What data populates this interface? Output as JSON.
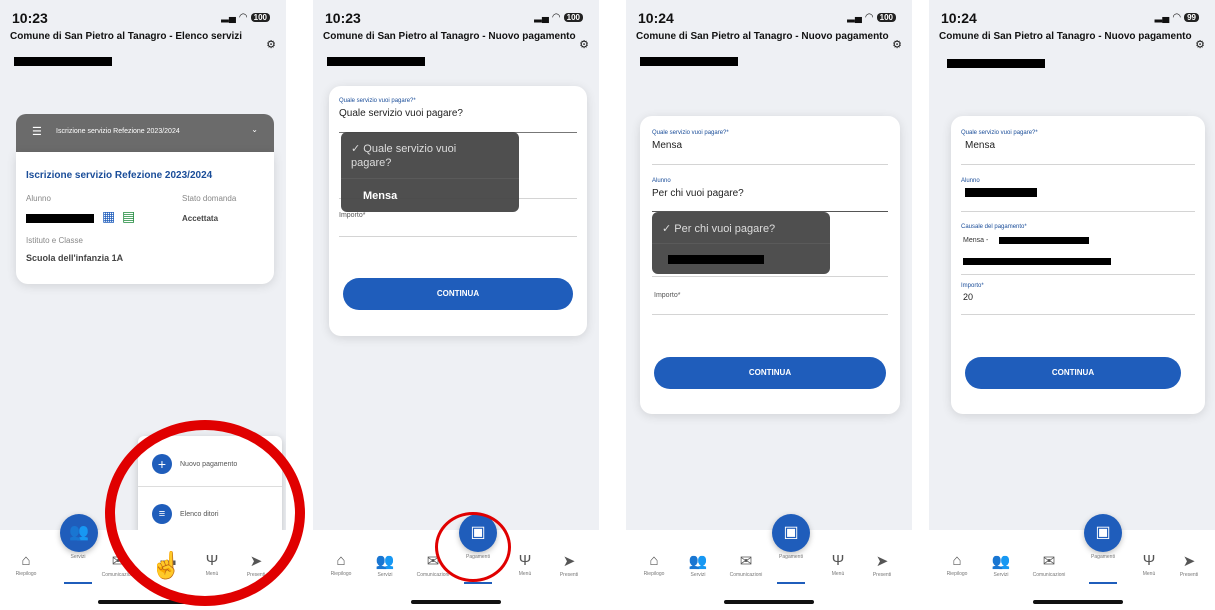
{
  "colors": {
    "accent": "#1f5dbb",
    "annotation": "#e00000",
    "dropdown_bg": "#464646"
  },
  "screen1": {
    "time": "10:23",
    "battery": "100",
    "title": "Comune di San Pietro al Tanagro - Elenco servizi",
    "banner": "Iscrizione servizio Refezione 2023/2024",
    "card_title": "Iscrizione servizio Refezione 2023/2024",
    "alunno_label": "Alunno",
    "stato_label": "Stato domanda",
    "stato_value": "Accettata",
    "istituto_label": "Istituto e Classe",
    "istituto_value": "Scuola dell'infanzia  1A",
    "menu": {
      "new_payment": "Nuovo pagamento",
      "payment_list": "Elenco ditori"
    },
    "tabs": [
      "Riepilogo",
      "Servizi",
      "Comunicazioni",
      "",
      "Menù",
      "Presenti"
    ]
  },
  "screen2": {
    "time": "10:23",
    "battery": "100",
    "title": "Comune di San Pietro al Tanagro - Nuovo pagamento",
    "service_label": "Quale servizio vuoi pagare?*",
    "service_value": "Quale servizio vuoi pagare?",
    "dropdown": {
      "option_placeholder": "Quale servizio vuoi pagare?",
      "option_mensa": "Mensa"
    },
    "importo_label": "Importo*",
    "button": "CONTINUA",
    "tabs": [
      "Riepilogo",
      "Servizi",
      "Comunicazioni",
      "Pagamenti",
      "Menù",
      "Presenti"
    ]
  },
  "screen3": {
    "time": "10:24",
    "battery": "100",
    "title": "Comune di San Pietro al Tanagro - Nuovo pagamento",
    "service_label": "Quale servizio vuoi pagare?*",
    "service_value": "Mensa",
    "alunno_label": "Alunno",
    "alunno_value": "Per chi vuoi pagare?",
    "dropdown": {
      "option_placeholder": "Per chi vuoi pagare?"
    },
    "importo_label": "Importo*",
    "button": "CONTINUA",
    "tabs": [
      "Riepilogo",
      "Servizi",
      "Comunicazioni",
      "Pagamenti",
      "Menù",
      "Presenti"
    ]
  },
  "screen4": {
    "time": "10:24",
    "battery": "99",
    "title": "Comune di San Pietro al Tanagro - Nuovo pagamento",
    "service_label": "Quale servizio vuoi pagare?*",
    "service_value": "Mensa",
    "alunno_label": "Alunno",
    "causale_label": "Causale del pagamento*",
    "causale_value": "Mensa -",
    "importo_label": "Importo*",
    "importo_value": "20",
    "button": "CONTINUA",
    "tabs": [
      "Riepilogo",
      "Servizi",
      "Comunicazioni",
      "Pagamenti",
      "Menù",
      "Presenti"
    ]
  }
}
